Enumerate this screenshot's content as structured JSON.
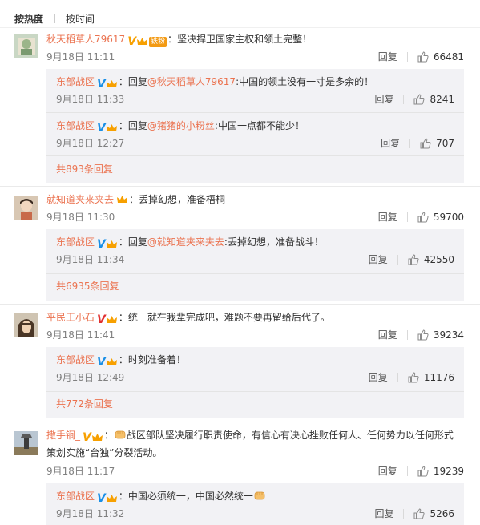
{
  "sort": {
    "hot": "按热度",
    "time": "按时间"
  },
  "comments": [
    {
      "user": "秋天稻草人79617",
      "fan_label": "铁粉",
      "text": "坚决捍卫国家主权和领土完整！",
      "time": "9月18日 11:11",
      "reply_label": "回复",
      "likes": "66481",
      "replies": [
        {
          "user": "东部战区",
          "reply_word": "回复",
          "mention": "@秋天稻草人79617",
          "text": "中国的领土没有一寸是多余的！",
          "time": "9月18日 11:33",
          "reply_label": "回复",
          "likes": "8241"
        },
        {
          "user": "东部战区",
          "reply_word": "回复",
          "mention": "@猪猪的小粉丝",
          "text": "中国一点都不能少！",
          "time": "9月18日 12:27",
          "reply_label": "回复",
          "likes": "707"
        }
      ],
      "more": "共893条回复"
    },
    {
      "user": "就知道夹来夹去",
      "text": "丢掉幻想，准备梧桐",
      "time": "9月18日 11:30",
      "reply_label": "回复",
      "likes": "59700",
      "replies": [
        {
          "user": "东部战区",
          "reply_word": "回复",
          "mention": "@就知道夹来夹去",
          "text": "丢掉幻想，准备战斗！",
          "time": "9月18日 11:34",
          "reply_label": "回复",
          "likes": "42550"
        }
      ],
      "more": "共6935条回复"
    },
    {
      "user": "平民王小石",
      "text": "统一就在我辈完成吧，难题不要再留给后代了。",
      "time": "9月18日 11:41",
      "reply_label": "回复",
      "likes": "39234",
      "replies": [
        {
          "user": "东部战区",
          "text": "时刻准备着！",
          "time": "9月18日 12:49",
          "reply_label": "回复",
          "likes": "11176"
        }
      ],
      "more": "共772条回复"
    },
    {
      "user": "撒手锏_",
      "text_line1": "战区部队坚决履行职责使命，有信心有决心挫败任何人、任何势力以任何形式",
      "text_line2": "策划实施“台独”分裂活动。",
      "time": "9月18日 11:17",
      "reply_label": "回复",
      "likes": "19239",
      "replies": [
        {
          "user": "东部战区",
          "text": "中国必须统一，中国必然统一",
          "time": "9月18日 11:32",
          "reply_label": "回复",
          "likes": "5266"
        }
      ]
    }
  ],
  "colors": {
    "accent": "#eb7350",
    "text": "#333333",
    "muted": "#808080",
    "reply_bg": "#f2f2f5",
    "verified_blue": "#1a8fe6"
  }
}
